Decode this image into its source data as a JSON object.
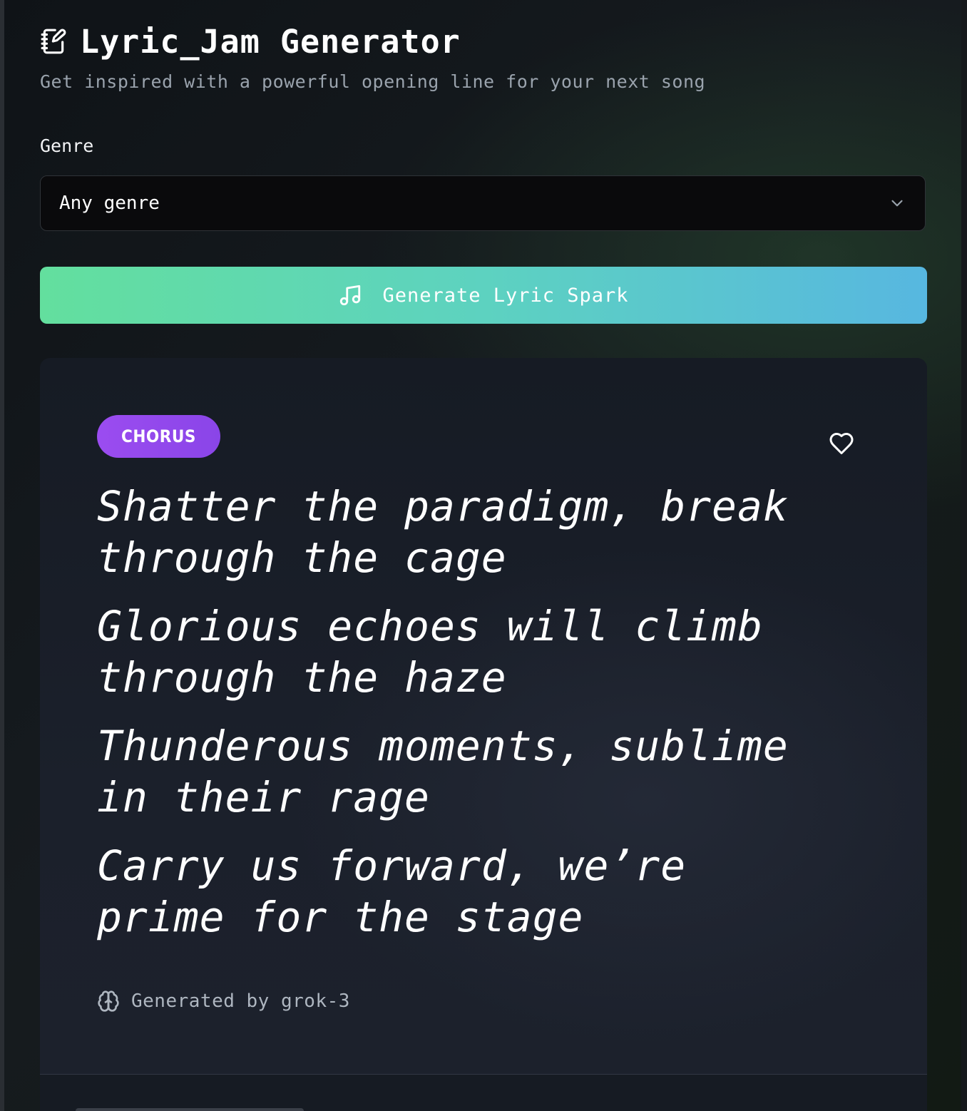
{
  "app": {
    "title": "Lyric_Jam Generator",
    "subtitle": "Get inspired with a powerful opening line for your next song"
  },
  "form": {
    "genre_label": "Genre",
    "genre_selected": "Any genre",
    "generate_button_label": "Generate Lyric Spark"
  },
  "result": {
    "section_badge": "CHORUS",
    "lines": [
      "Shatter the paradigm, break through the cage",
      "Glorious echoes will climb through the haze",
      "Thunderous moments, sublime in their rage",
      "Carry us forward, we’re prime for the stage"
    ],
    "generated_by": "Generated by grok-3"
  },
  "icons": {
    "title": "notebook-pen-icon",
    "select": "chevron-down-icon",
    "button": "music-note-icon",
    "favorite": "heart-icon",
    "model": "brain-icon"
  },
  "colors": {
    "background": "#0f1317",
    "button_gradient_start": "#63df9e",
    "button_gradient_end": "#57b7e0",
    "badge": "#9b4cf0",
    "card": "#1b202b",
    "select_bg": "#0a0a0c"
  }
}
